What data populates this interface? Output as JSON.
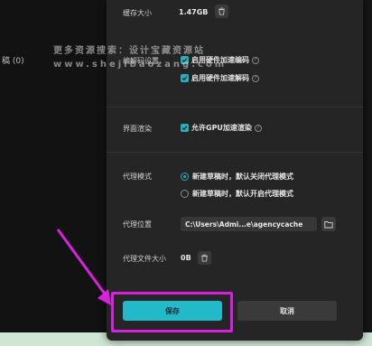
{
  "background": {
    "left_text": "稿 (0)"
  },
  "settings": {
    "cache": {
      "label": "缓存大小",
      "value": "1.47GB"
    },
    "codec": {
      "label": "编解码设置",
      "options": [
        {
          "label": "启用硬件加速编码",
          "checked": true
        },
        {
          "label": "启用硬件加速解码",
          "checked": true
        }
      ]
    },
    "render": {
      "label": "界面渲染",
      "option": {
        "label": "允许GPU加速渲染",
        "checked": true
      }
    },
    "proxy_mode": {
      "label": "代理模式",
      "options": [
        {
          "label": "新建草稿时，默认关闭代理模式",
          "selected": true
        },
        {
          "label": "新建草稿时，默认开启代理模式",
          "selected": false
        }
      ]
    },
    "proxy_location": {
      "label": "代理位置",
      "path": "C:\\Users\\Admi...e\\agencycache"
    },
    "proxy_size": {
      "label": "代理文件大小",
      "value": "0B"
    }
  },
  "buttons": {
    "save": "保存",
    "cancel": "取消"
  },
  "watermark": {
    "line1": "更多资源搜索：设计宝藏资源站",
    "line2": "www.shejibaozang.com"
  },
  "colors": {
    "accent": "#22b9c9",
    "highlight": "#d820e0",
    "dialog_bg": "#252525"
  }
}
